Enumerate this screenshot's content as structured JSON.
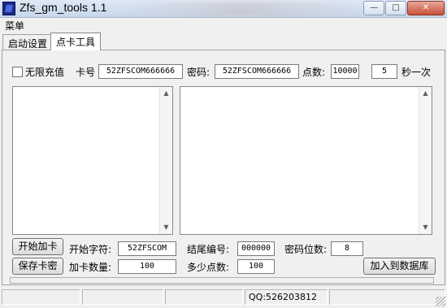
{
  "window": {
    "title": "Zfs_gm_tools 1.1",
    "controls": {
      "minimize": "—",
      "maximize": "□",
      "close": "✕"
    }
  },
  "menu": {
    "items": [
      "菜单"
    ]
  },
  "tabs": [
    {
      "label": "启动设置",
      "active": false
    },
    {
      "label": "点卡工具",
      "active": true
    }
  ],
  "top_row": {
    "unlimited_label": "无限充值",
    "unlimited_checked": false,
    "card_label": "卡号",
    "card_value": "52ZFSCOM666666",
    "password_label": "密码:",
    "password_value": "52ZFSCOM666666",
    "points_label": "点数:",
    "points_value": "10000",
    "interval_value": "5",
    "interval_label": "秒一次"
  },
  "controls": {
    "start_add_button": "开始加卡",
    "save_card_button": "保存卡密",
    "start_char_label": "开始字符:",
    "start_char_value": "52ZFSCOM",
    "end_number_label": "结尾编号:",
    "end_number_value": "000000",
    "password_digits_label": "密码位数:",
    "password_digits_value": "8",
    "add_count_label": "加卡数量:",
    "add_count_value": "100",
    "points_count_label": "多少点数:",
    "points_count_value": "100",
    "add_to_db_button": "加入到数据库"
  },
  "status": {
    "panels": [
      "",
      "",
      "",
      "QQ:526203812",
      ""
    ]
  },
  "icons": {
    "scroll_up": "▲",
    "scroll_down": "▼"
  }
}
